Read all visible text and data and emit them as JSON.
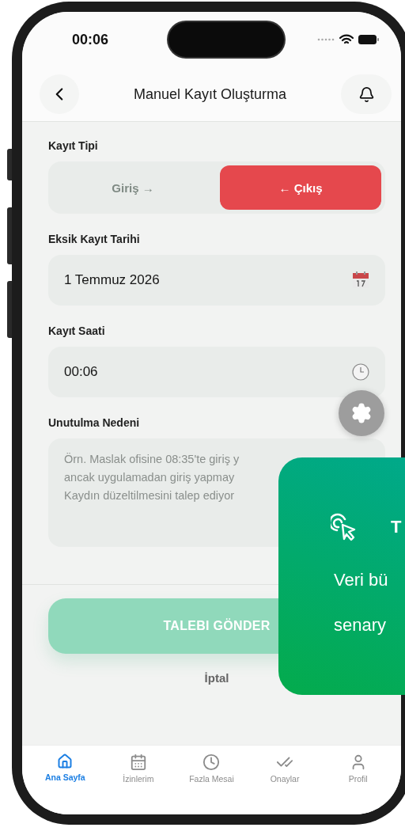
{
  "status_bar": {
    "time": "00:06"
  },
  "header": {
    "title": "Manuel Kayıt Oluşturma"
  },
  "record_type": {
    "label": "Kayıt Tipi",
    "options": [
      {
        "label": "Giriş →",
        "selected": false
      },
      {
        "label": "← Çıkış",
        "selected": true
      }
    ]
  },
  "date_field": {
    "label": "Eksik Kayıt Tarihi",
    "value": "1 Temmuz 2026"
  },
  "time_field": {
    "label": "Kayıt Saati",
    "value": "00:06"
  },
  "reason_field": {
    "label": "Unutulma Nedeni",
    "placeholder": [
      "Örn. Maslak ofisine 08:35'te giriş y",
      "ancak uygulamadan giriş yapmay",
      "Kaydın düzeltilmesini talep ediyor"
    ]
  },
  "submit_button": {
    "label": "TALEBI GÖNDER",
    "disabled": true
  },
  "cancel_link": {
    "label": "İptal"
  },
  "tabs": [
    {
      "kind": "home",
      "label": "Ana Sayfa",
      "selected": true
    },
    {
      "kind": "calendar",
      "label": "İzinlerim",
      "selected": false
    },
    {
      "kind": "clock",
      "label": "Fazla Mesai",
      "selected": false
    },
    {
      "kind": "checks",
      "label": "Onaylar",
      "selected": false
    },
    {
      "kind": "user",
      "label": "Profil",
      "selected": false
    }
  ],
  "overlay_card": {
    "title": "T",
    "lines": [
      "Veri bü",
      "senary"
    ]
  }
}
